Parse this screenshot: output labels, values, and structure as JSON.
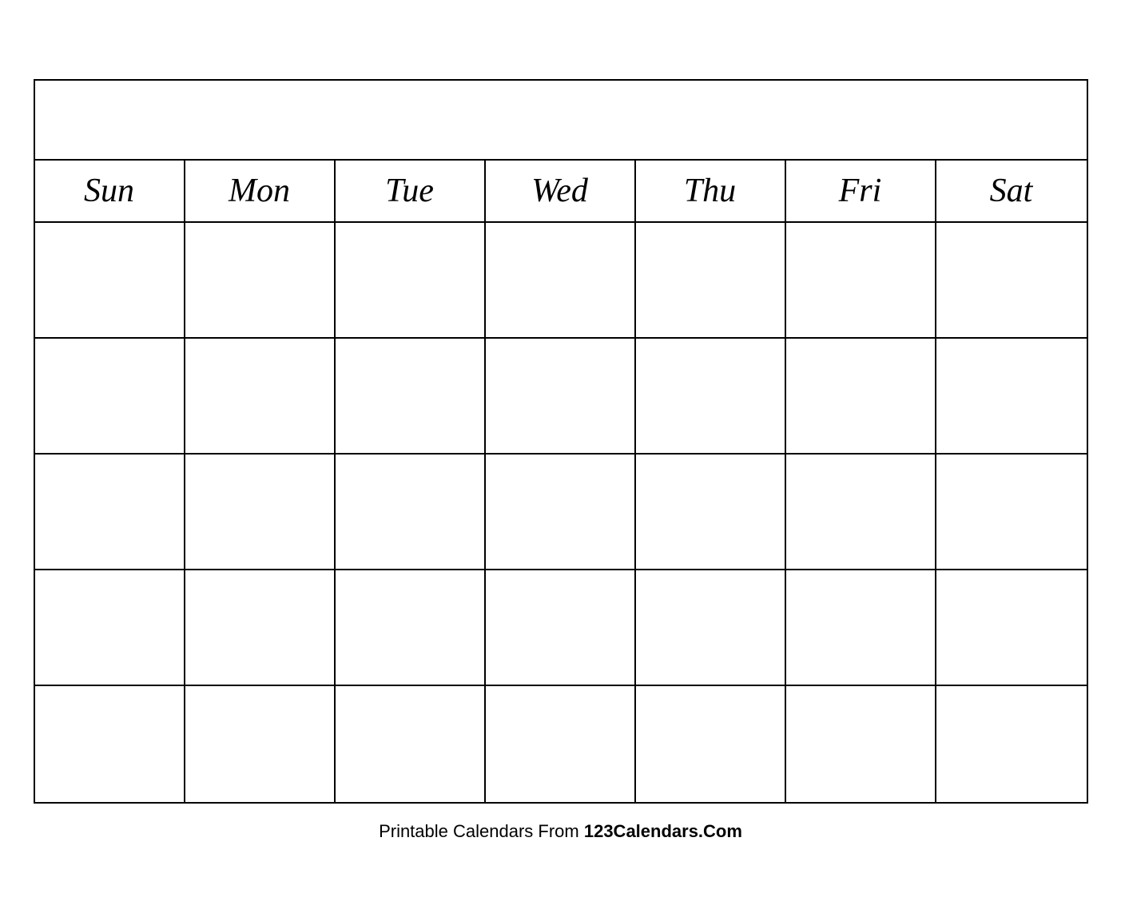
{
  "calendar": {
    "days": [
      "Sun",
      "Mon",
      "Tue",
      "Wed",
      "Thu",
      "Fri",
      "Sat"
    ],
    "rows": 5
  },
  "footer": {
    "text_regular": "Printable Calendars From ",
    "text_bold": "123Calendars.Com"
  }
}
